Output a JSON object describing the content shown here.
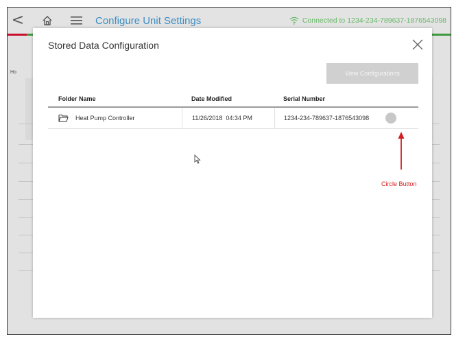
{
  "topbar": {
    "back_glyph": "<",
    "title": "Configure Unit Settings",
    "connection_text": "Connected to 1234-234-789637-1876543098",
    "icons": [
      "chevron-left-icon",
      "home-icon",
      "hamburger-menu-icon",
      "wifi-icon"
    ]
  },
  "background": {
    "crumb": "Ho"
  },
  "modal": {
    "title": "Stored Data Configuration",
    "view_button_label": "View Configurations",
    "columns": [
      "Folder Name",
      "Date Modified",
      "Serial Number"
    ],
    "rows": [
      {
        "folder": "Heat Pump Controller",
        "date": "11/26/2018  04:34 PM",
        "serial": "1234-234-789637-1876543098"
      }
    ]
  },
  "annotation": {
    "label": "Circle Button",
    "color": "#d21e1e"
  },
  "colors": {
    "title_blue": "#3b8fc4",
    "connected_green": "#69b869",
    "accent_green": "#3c9a3c",
    "accent_red": "#c8102e"
  }
}
